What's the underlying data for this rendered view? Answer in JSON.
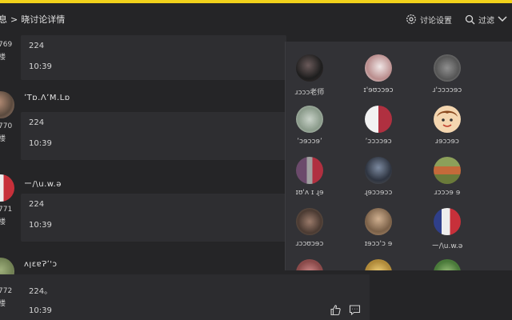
{
  "header": {
    "breadcrumb_prev": "息",
    "breadcrumb_sep": ">",
    "breadcrumb_current": "晓讨论详情",
    "settings_label": "讨论设置",
    "filter_label": "过滤"
  },
  "posts": [
    {
      "floor_num": "769",
      "floor_unit": "楼",
      "username": "",
      "content": "224",
      "time": "10:39"
    },
    {
      "floor_num": "770",
      "floor_unit": "楼",
      "username": "ʼTɒ.ɅʼM.Lɒ",
      "content": "224",
      "time": "10:39"
    },
    {
      "floor_num": "771",
      "floor_unit": "楼",
      "username": "ー/\\u.w.ǝ",
      "content": "224",
      "time": "10:39"
    },
    {
      "floor_num": "772",
      "floor_unit": "楼",
      "username": "ʌꞁɛɐɁʼ'ɔ",
      "content": "224。",
      "time": "10:39"
    }
  ],
  "popup_users": [
    {
      "name": "ɹɔɔɔ老师",
      "avatar": "dark-portrait"
    },
    {
      "name": "ɪ'ɘʊɔɔɘɔ",
      "avatar": "light-portrait"
    },
    {
      "name": "ɹ'ɔɔɔɔɘɔ",
      "avatar": "gray-portrait"
    },
    {
      "name": "ʼɔɘɔɔɘʼ",
      "avatar": "pale-portrait"
    },
    {
      "name": "ʼɔɔɔɔɘɔ",
      "avatar": "red-white-portrait"
    },
    {
      "name": "ɹɘɔɔɘɔ",
      "avatar": "cartoon-face"
    },
    {
      "name": "ɪʊ'ʌ ɪ ɻɘ",
      "avatar": "purple-portrait"
    },
    {
      "name": "ɻɘɔɔɘɔɔ",
      "avatar": "dark-blue-portrait"
    },
    {
      "name": "ɹɔɔɔɘ ɘ",
      "avatar": "landscape"
    },
    {
      "name": "ɹɔɔʊɔɘɔ",
      "avatar": "brown-portrait"
    },
    {
      "name": "ɪɘɔɔ'ɔ ɘ",
      "avatar": "tan-portrait"
    },
    {
      "name": "ー/\\u.w.ǝ",
      "avatar": "blue-red-portrait"
    }
  ],
  "colors": {
    "accent": "#f2d21b",
    "background": "#252527",
    "panel": "#2e2e31",
    "popup": "#323236"
  },
  "icons": {
    "settings": "gear-icon",
    "filter": "search-icon",
    "dropdown": "chevron-down-icon",
    "like": "thumbs-up-icon",
    "comment": "comment-icon"
  }
}
